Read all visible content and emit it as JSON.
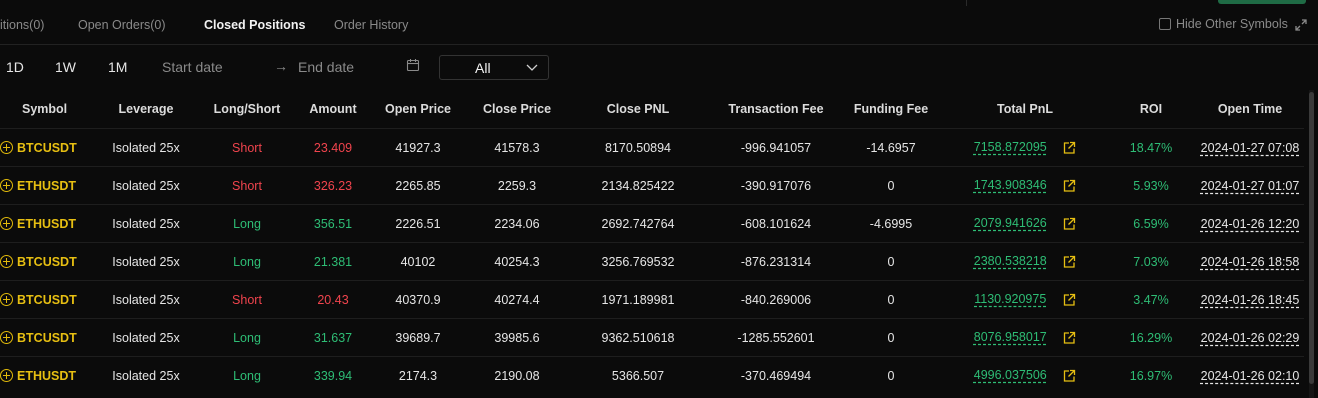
{
  "tabs": [
    {
      "label": "itions(0)"
    },
    {
      "label": "Open Orders(0)"
    },
    {
      "label": "Closed Positions"
    },
    {
      "label": "Order History"
    }
  ],
  "hide_other_symbols": {
    "label": "Hide Other Symbols",
    "checked": false
  },
  "filters": {
    "periods": [
      "1D",
      "1W",
      "1M"
    ],
    "start_placeholder": "Start date",
    "arrow": "→",
    "end_placeholder": "End date",
    "select_value": "All"
  },
  "columns": [
    "Symbol",
    "Leverage",
    "Long/Short",
    "Amount",
    "Open Price",
    "Close Price",
    "Close PNL",
    "Transaction Fee",
    "Funding Fee",
    "Total PnL",
    "ROI",
    "Open Time"
  ],
  "colors": {
    "short": "#f0444d",
    "long": "#2ebd75",
    "symbol": "#e7bf12"
  },
  "rows": [
    {
      "symbol": "BTCUSDT",
      "leverage": "Isolated 25x",
      "side": "Short",
      "amount": "23.409",
      "open_price": "41927.3",
      "close_price": "41578.3",
      "close_pnl": "8170.50894",
      "tx_fee": "-996.941057",
      "funding_fee": "-14.6957",
      "total_pnl": "7158.872095",
      "roi": "18.47%",
      "open_time": "2024-01-27 07:08"
    },
    {
      "symbol": "ETHUSDT",
      "leverage": "Isolated 25x",
      "side": "Short",
      "amount": "326.23",
      "open_price": "2265.85",
      "close_price": "2259.3",
      "close_pnl": "2134.825422",
      "tx_fee": "-390.917076",
      "funding_fee": "0",
      "total_pnl": "1743.908346",
      "roi": "5.93%",
      "open_time": "2024-01-27 01:07"
    },
    {
      "symbol": "ETHUSDT",
      "leverage": "Isolated 25x",
      "side": "Long",
      "amount": "356.51",
      "open_price": "2226.51",
      "close_price": "2234.06",
      "close_pnl": "2692.742764",
      "tx_fee": "-608.101624",
      "funding_fee": "-4.6995",
      "total_pnl": "2079.941626",
      "roi": "6.59%",
      "open_time": "2024-01-26 12:20"
    },
    {
      "symbol": "BTCUSDT",
      "leverage": "Isolated 25x",
      "side": "Long",
      "amount": "21.381",
      "open_price": "40102",
      "close_price": "40254.3",
      "close_pnl": "3256.769532",
      "tx_fee": "-876.231314",
      "funding_fee": "0",
      "total_pnl": "2380.538218",
      "roi": "7.03%",
      "open_time": "2024-01-26 18:58"
    },
    {
      "symbol": "BTCUSDT",
      "leverage": "Isolated 25x",
      "side": "Short",
      "amount": "20.43",
      "open_price": "40370.9",
      "close_price": "40274.4",
      "close_pnl": "1971.189981",
      "tx_fee": "-840.269006",
      "funding_fee": "0",
      "total_pnl": "1130.920975",
      "roi": "3.47%",
      "open_time": "2024-01-26 18:45"
    },
    {
      "symbol": "BTCUSDT",
      "leverage": "Isolated 25x",
      "side": "Long",
      "amount": "31.637",
      "open_price": "39689.7",
      "close_price": "39985.6",
      "close_pnl": "9362.510618",
      "tx_fee": "-1285.552601",
      "funding_fee": "0",
      "total_pnl": "8076.958017",
      "roi": "16.29%",
      "open_time": "2024-01-26 02:29"
    },
    {
      "symbol": "ETHUSDT",
      "leverage": "Isolated 25x",
      "side": "Long",
      "amount": "339.94",
      "open_price": "2174.3",
      "close_price": "2190.08",
      "close_pnl": "5366.507",
      "tx_fee": "-370.469494",
      "funding_fee": "0",
      "total_pnl": "4996.037506",
      "roi": "16.97%",
      "open_time": "2024-01-26 02:10"
    }
  ]
}
